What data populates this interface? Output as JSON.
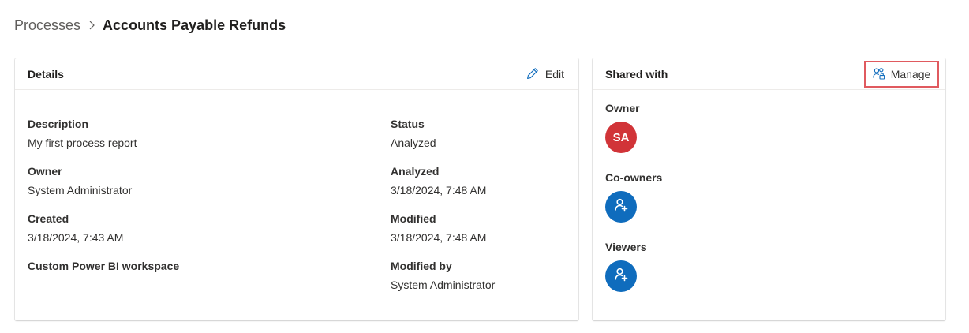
{
  "breadcrumb": {
    "parent": "Processes",
    "current": "Accounts Payable Refunds"
  },
  "details": {
    "title": "Details",
    "edit_label": "Edit",
    "fields": {
      "description": {
        "label": "Description",
        "value": "My first process report"
      },
      "owner": {
        "label": "Owner",
        "value": "System Administrator"
      },
      "created": {
        "label": "Created",
        "value": "3/18/2024, 7:43 AM"
      },
      "workspace": {
        "label": "Custom Power BI workspace",
        "value": "—"
      },
      "status": {
        "label": "Status",
        "value": "Analyzed"
      },
      "analyzed": {
        "label": "Analyzed",
        "value": "3/18/2024, 7:48 AM"
      },
      "modified": {
        "label": "Modified",
        "value": "3/18/2024, 7:48 AM"
      },
      "modified_by": {
        "label": "Modified by",
        "value": "System Administrator"
      }
    }
  },
  "shared": {
    "title": "Shared with",
    "manage_label": "Manage",
    "owner_label": "Owner",
    "owner_initials": "SA",
    "coowners_label": "Co-owners",
    "viewers_label": "Viewers"
  },
  "icons": {
    "breadcrumb_separator": "chevron-right-icon",
    "edit": "pencil-icon",
    "manage": "people-lock-icon",
    "add_person": "person-add-icon"
  },
  "colors": {
    "accent": "#0f6cbd",
    "owner_avatar": "#d13438",
    "highlight_border": "#e05a5f"
  }
}
